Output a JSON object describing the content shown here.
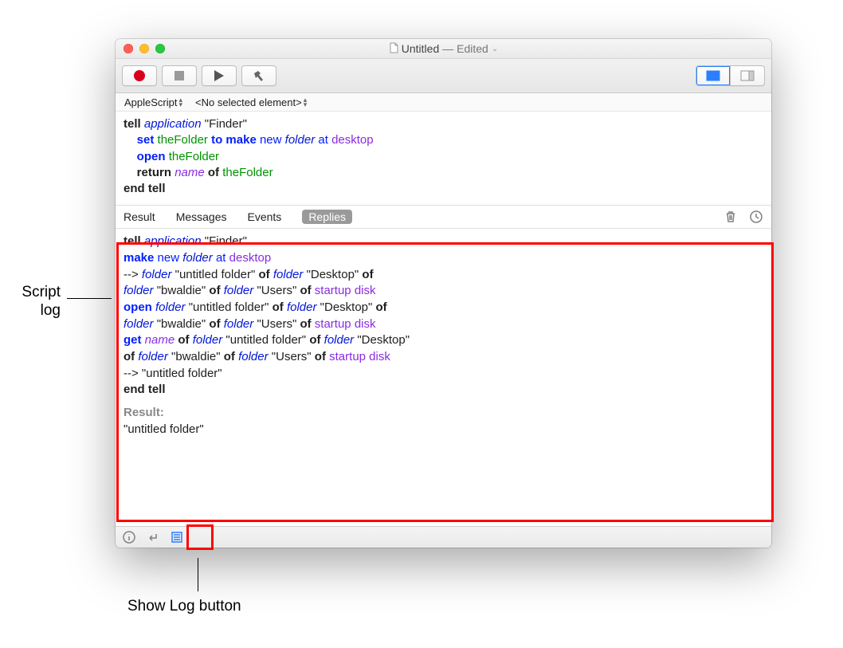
{
  "window": {
    "doc_icon": "script-icon",
    "title_name": "Untitled",
    "title_suffix": " — Edited"
  },
  "toolbar": {
    "record_name": "record-button",
    "stop_name": "stop-button",
    "run_name": "run-button",
    "compile_name": "compile-button",
    "view_main_name": "show-main-view-button",
    "view_split_name": "show-split-view-button"
  },
  "crumbs": {
    "language": "AppleScript",
    "element": "<No selected element>"
  },
  "code_tokens": [
    [
      "b",
      "tell"
    ],
    [
      "sp",
      " "
    ],
    [
      "i iblue",
      "application"
    ],
    [
      "sp",
      " "
    ],
    [
      "",
      "\"Finder\""
    ],
    [
      "br"
    ],
    [
      "sp",
      "    "
    ],
    [
      "b blue",
      "set"
    ],
    [
      "sp",
      " "
    ],
    [
      "green",
      "theFolder"
    ],
    [
      "sp",
      " "
    ],
    [
      "b blue",
      "to"
    ],
    [
      "sp",
      " "
    ],
    [
      "b blue",
      "make"
    ],
    [
      "sp",
      " "
    ],
    [
      "blue",
      "new"
    ],
    [
      "sp",
      " "
    ],
    [
      "i iblue",
      "folder"
    ],
    [
      "sp",
      " "
    ],
    [
      "blue",
      "at"
    ],
    [
      "sp",
      " "
    ],
    [
      "purple",
      "desktop"
    ],
    [
      "br"
    ],
    [
      "sp",
      "    "
    ],
    [
      "b blue",
      "open"
    ],
    [
      "sp",
      " "
    ],
    [
      "green",
      "theFolder"
    ],
    [
      "br"
    ],
    [
      "sp",
      "    "
    ],
    [
      "b",
      "return"
    ],
    [
      "sp",
      " "
    ],
    [
      "i purple",
      "name"
    ],
    [
      "sp",
      " "
    ],
    [
      "b",
      "of"
    ],
    [
      "sp",
      " "
    ],
    [
      "green",
      "theFolder"
    ],
    [
      "br"
    ],
    [
      "b",
      "end"
    ],
    [
      "sp",
      " "
    ],
    [
      "b",
      "tell"
    ]
  ],
  "log": {
    "tabs": [
      "Result",
      "Messages",
      "Events",
      "Replies"
    ],
    "active_tab": 3,
    "trash_name": "clear-log-button",
    "history_name": "log-history-button"
  },
  "log_tokens": [
    [
      "b",
      "tell"
    ],
    [
      "sp",
      " "
    ],
    [
      "i iblue",
      "application"
    ],
    [
      "sp",
      " "
    ],
    [
      "",
      "\"Finder\""
    ],
    [
      "br"
    ],
    [
      "sp",
      "    "
    ],
    [
      "b blue",
      "make"
    ],
    [
      "sp",
      " "
    ],
    [
      "blue",
      "new"
    ],
    [
      "sp",
      " "
    ],
    [
      "i iblue",
      "folder"
    ],
    [
      "sp",
      " "
    ],
    [
      "blue",
      "at"
    ],
    [
      "sp",
      " "
    ],
    [
      "purple",
      "desktop"
    ],
    [
      "br"
    ],
    [
      "sp",
      "        "
    ],
    [
      "",
      "-->"
    ],
    [
      "sp",
      " "
    ],
    [
      "i iblue",
      "folder"
    ],
    [
      "sp",
      " "
    ],
    [
      "",
      "\"untitled folder\""
    ],
    [
      "sp",
      " "
    ],
    [
      "b",
      "of"
    ],
    [
      "sp",
      " "
    ],
    [
      "i iblue",
      "folder"
    ],
    [
      "sp",
      " "
    ],
    [
      "",
      "\"Desktop\""
    ],
    [
      "sp",
      " "
    ],
    [
      "b",
      "of"
    ],
    [
      "sp",
      " "
    ],
    [
      "br"
    ],
    [
      "i iblue",
      "folder"
    ],
    [
      "sp",
      " "
    ],
    [
      "",
      "\"bwaldie\""
    ],
    [
      "sp",
      " "
    ],
    [
      "b",
      "of"
    ],
    [
      "sp",
      " "
    ],
    [
      "i iblue",
      "folder"
    ],
    [
      "sp",
      " "
    ],
    [
      "",
      "\"Users\""
    ],
    [
      "sp",
      " "
    ],
    [
      "b",
      "of"
    ],
    [
      "sp",
      " "
    ],
    [
      "purple",
      "startup disk"
    ],
    [
      "br"
    ],
    [
      "sp",
      "    "
    ],
    [
      "b blue",
      "open"
    ],
    [
      "sp",
      " "
    ],
    [
      "i iblue",
      "folder"
    ],
    [
      "sp",
      " "
    ],
    [
      "",
      "\"untitled folder\""
    ],
    [
      "sp",
      " "
    ],
    [
      "b",
      "of"
    ],
    [
      "sp",
      " "
    ],
    [
      "i iblue",
      "folder"
    ],
    [
      "sp",
      " "
    ],
    [
      "",
      "\"Desktop\""
    ],
    [
      "sp",
      " "
    ],
    [
      "b",
      "of"
    ],
    [
      "sp",
      " "
    ],
    [
      "br"
    ],
    [
      "i iblue",
      "folder"
    ],
    [
      "sp",
      " "
    ],
    [
      "",
      "\"bwaldie\""
    ],
    [
      "sp",
      " "
    ],
    [
      "b",
      "of"
    ],
    [
      "sp",
      " "
    ],
    [
      "i iblue",
      "folder"
    ],
    [
      "sp",
      " "
    ],
    [
      "",
      "\"Users\""
    ],
    [
      "sp",
      " "
    ],
    [
      "b",
      "of"
    ],
    [
      "sp",
      " "
    ],
    [
      "purple",
      "startup disk"
    ],
    [
      "br"
    ],
    [
      "sp",
      "    "
    ],
    [
      "b blue",
      "get"
    ],
    [
      "sp",
      " "
    ],
    [
      "i purple",
      "name"
    ],
    [
      "sp",
      " "
    ],
    [
      "b",
      "of"
    ],
    [
      "sp",
      " "
    ],
    [
      "i iblue",
      "folder"
    ],
    [
      "sp",
      " "
    ],
    [
      "",
      "\"untitled folder\""
    ],
    [
      "sp",
      " "
    ],
    [
      "b",
      "of"
    ],
    [
      "sp",
      " "
    ],
    [
      "i iblue",
      "folder"
    ],
    [
      "sp",
      " "
    ],
    [
      "",
      "\"Desktop\""
    ],
    [
      "sp",
      " "
    ],
    [
      "br"
    ],
    [
      "b",
      "of"
    ],
    [
      "sp",
      " "
    ],
    [
      "i iblue",
      "folder"
    ],
    [
      "sp",
      " "
    ],
    [
      "",
      "\"bwaldie\""
    ],
    [
      "sp",
      " "
    ],
    [
      "b",
      "of"
    ],
    [
      "sp",
      " "
    ],
    [
      "i iblue",
      "folder"
    ],
    [
      "sp",
      " "
    ],
    [
      "",
      "\"Users\""
    ],
    [
      "sp",
      " "
    ],
    [
      "b",
      "of"
    ],
    [
      "sp",
      " "
    ],
    [
      "purple",
      "startup disk"
    ],
    [
      "br"
    ],
    [
      "sp",
      "        "
    ],
    [
      "",
      "-->"
    ],
    [
      "sp",
      " "
    ],
    [
      "",
      "\"untitled folder\""
    ],
    [
      "br"
    ],
    [
      "b",
      "end"
    ],
    [
      "sp",
      " "
    ],
    [
      "b",
      "tell"
    ]
  ],
  "log_result": {
    "header": "Result:",
    "value": "\"untitled folder\""
  },
  "statusbar": {
    "info_name": "description-button",
    "enter_name": "insert-return-button",
    "log_name": "show-log-button"
  },
  "annotations": {
    "script_log": "Script\nlog",
    "show_log": "Show Log button"
  }
}
